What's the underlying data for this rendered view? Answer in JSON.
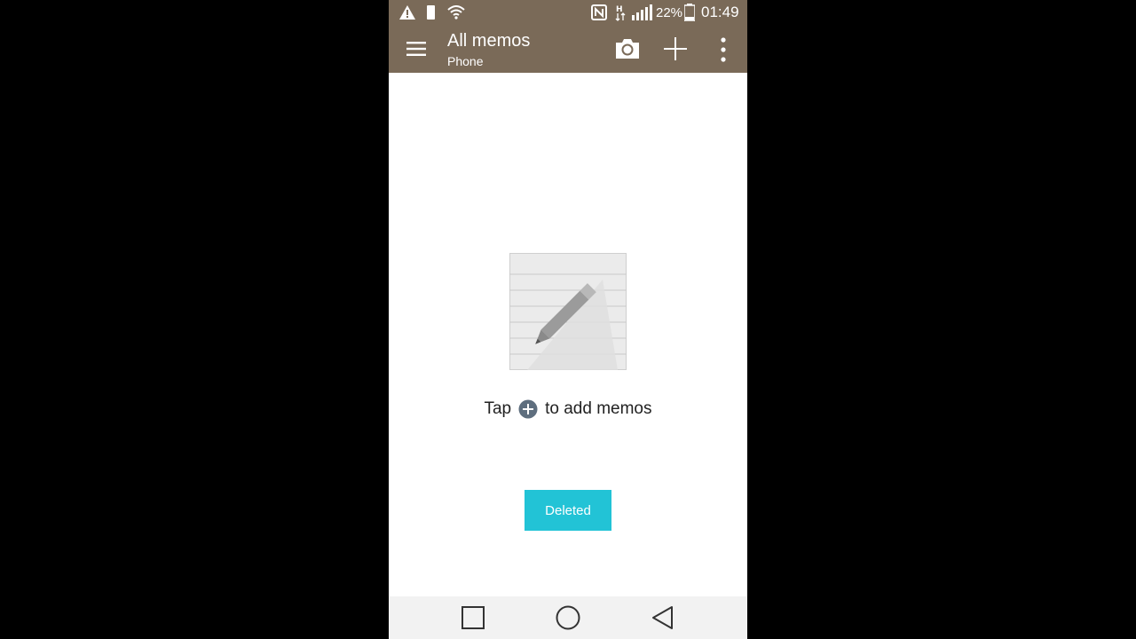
{
  "statusbar": {
    "icons": [
      "warning-icon",
      "battery-small-icon",
      "wifi-icon",
      "nfc-icon",
      "h-data-icon",
      "signal-icon",
      "battery-icon"
    ],
    "battery_percent": "22%",
    "time": "01:49"
  },
  "appbar": {
    "title": "All memos",
    "subtitle": "Phone",
    "icons": [
      "menu-icon",
      "camera-icon",
      "add-icon",
      "more-vert-icon"
    ]
  },
  "empty_state": {
    "text_before": "Tap",
    "text_after": "to add memos",
    "inline_icon": "add-circle-icon"
  },
  "toast": {
    "label": "Deleted"
  },
  "navbar": {
    "icons": [
      "recents-icon",
      "home-icon",
      "back-icon"
    ]
  },
  "colors": {
    "appbar": "#7a6a58",
    "toast": "#22c3d6",
    "navbar": "#f2f2f2"
  }
}
